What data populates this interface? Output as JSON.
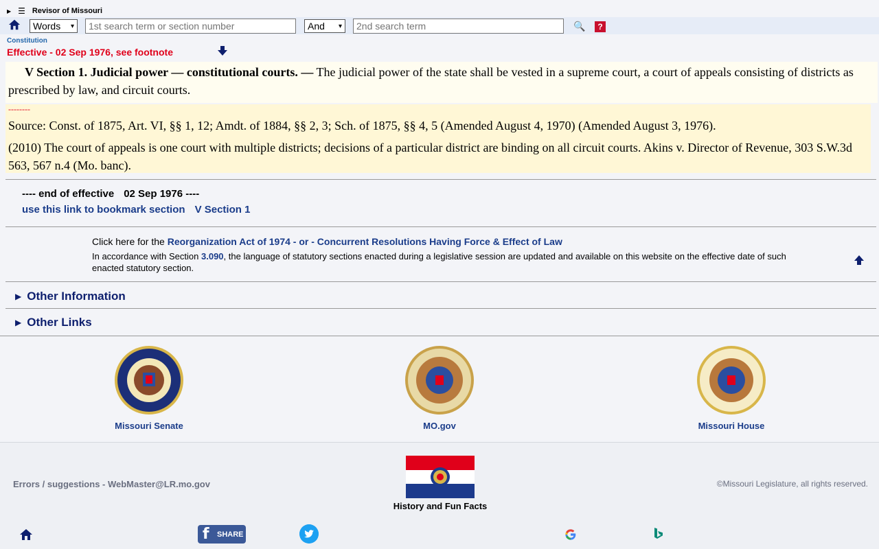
{
  "header": {
    "site_title": "Revisor of Missouri",
    "search": {
      "type_select": "Words",
      "term1_placeholder": "1st search term or section number",
      "operator_select": "And",
      "term2_placeholder": "2nd search term",
      "help_label": "?"
    }
  },
  "breadcrumb": "Constitution",
  "effective_notice": "Effective - 02 Sep 1976, see footnote",
  "section": {
    "heading": "V Section 1.  Judicial power — constitutional courts. —",
    "body": "The judicial power of the state shall be vested in a supreme court, a court of appeals consisting of districts as prescribed by law, and circuit courts.",
    "divider": "--------",
    "source": "Source: Const. of 1875, Art. VI, §§ 1, 12; Amdt. of 1884, §§ 2, 3; Sch. of 1875, §§ 4, 5 (Amended August 4, 1970) (Amended August 3, 1976).",
    "note": "(2010) The court of appeals is one court with multiple districts; decisions of a particular district are binding on all circuit courts. Akins v. Director of Revenue, 303 S.W.3d 563, 567 n.4 (Mo. banc)."
  },
  "end_of_effective": {
    "prefix": "---- end of effective",
    "date": "02 Sep 1976 ----"
  },
  "bookmark": {
    "label": "use this link to bookmark section",
    "section": "V Section 1"
  },
  "reorg": {
    "prefix": "Click here for the",
    "link1": "Reorganization Act of 1974",
    "sep": "- or -",
    "link2": "Concurrent Resolutions Having Force & Effect of Law"
  },
  "accordance": {
    "pre": "In accordance with Section",
    "section_link": "3.090",
    "post": ", the language of statutory sections enacted during a legislative session are updated and available on this website on the effective date of such enacted statutory section."
  },
  "expanders": {
    "other_information": "Other Information",
    "other_links": "Other Links"
  },
  "seals": {
    "senate": "Missouri Senate",
    "mogov": "MO.gov",
    "house": "Missouri House"
  },
  "footer": {
    "errors": "Errors / suggestions - WebMaster@LR.mo.gov",
    "copyright": "©Missouri Legislature, all rights reserved.",
    "history": "History and Fun Facts",
    "share": "SHARE",
    "fb_letter": "f"
  },
  "colors": {
    "accent_red": "#e0001a",
    "link_blue": "#1a3c8a",
    "facebook": "#3b5998",
    "twitter": "#1da1f2"
  }
}
